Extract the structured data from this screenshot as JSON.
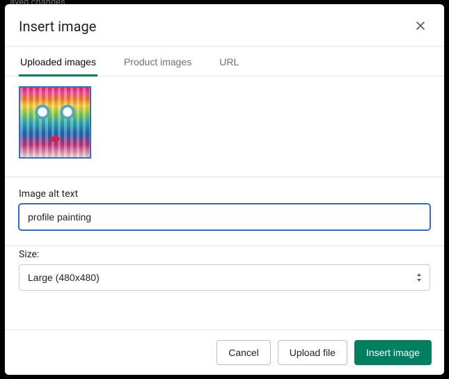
{
  "modal": {
    "title": "Insert image",
    "tabs": [
      {
        "label": "Uploaded images"
      },
      {
        "label": "Product images"
      },
      {
        "label": "URL"
      }
    ],
    "alt_label": "Image alt text",
    "alt_value": "profile painting",
    "size_label": "Size:",
    "size_value": "Large (480x480)"
  },
  "footer": {
    "cancel": "Cancel",
    "upload": "Upload file",
    "insert": "Insert image"
  },
  "icons": {
    "close": "close-icon",
    "updown": "updown-icon"
  }
}
